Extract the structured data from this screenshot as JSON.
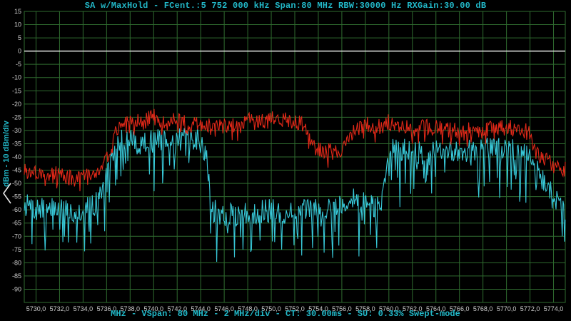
{
  "title": "SA w/MaxHold - FCent.:5 752 000 kHz Span:80 MHz RBW:30000 Hz RXGain:30.00 dB",
  "footer": "MHz - VSpan: 80 MHz - 2 MHz/div - CT: 30.00ms - SU: 0.33% Swept-mode",
  "y_axis_label": "dBm - 10 dBm/div",
  "colors": {
    "background": "#000000",
    "grid": "#2f6b2f",
    "text": "#22b8c8",
    "maxhold_trace": "#e02818",
    "live_trace": "#38c8d8",
    "reference_line": "#e6e6e6"
  },
  "icons": {
    "left_arrow": "chevron-left-icon"
  },
  "chart_data": {
    "type": "line",
    "title": "SA w/MaxHold - FCent.:5 752 000 kHz Span:80 MHz RBW:30000 Hz RXGain:30.00 dB",
    "xlabel": "MHz",
    "ylabel": "dBm - 10 dBm/div",
    "xlim": [
      5729.0,
      5775.0
    ],
    "ylim": [
      -95,
      15
    ],
    "grid": true,
    "x_ticks": [
      "5730,0",
      "5732,0",
      "5734,0",
      "5736,0",
      "5738,0",
      "5740,0",
      "5742,0",
      "5744,0",
      "5746,0",
      "5748,0",
      "5750,0",
      "5752,0",
      "5754,0",
      "5756,0",
      "5758,0",
      "5760,0",
      "5762,0",
      "5764,0",
      "5766,0",
      "5768,0",
      "5770,0",
      "5772,0",
      "5774,0"
    ],
    "y_ticks": [
      "15",
      "10",
      "5",
      "0",
      "-5",
      "-10",
      "-15",
      "-20",
      "-25",
      "-30",
      "-35",
      "-40",
      "-45",
      "-50",
      "-55",
      "-60",
      "-65",
      "-70",
      "-75",
      "-80",
      "-85",
      "-90"
    ],
    "reference_line_y": 0,
    "series": [
      {
        "role": "max hold",
        "color": "#e02818",
        "x": [
          5729.0,
          5730.0,
          5731.0,
          5732.0,
          5733.0,
          5734.0,
          5735.0,
          5735.5,
          5736.0,
          5736.5,
          5737.0,
          5737.5,
          5738.0,
          5739.0,
          5740.0,
          5741.0,
          5742.0,
          5743.0,
          5744.0,
          5745.0,
          5746.0,
          5747.0,
          5748.0,
          5749.0,
          5750.0,
          5751.0,
          5752.0,
          5752.8,
          5753.2,
          5754.0,
          5755.0,
          5756.0,
          5756.5,
          5757.0,
          5758.0,
          5759.0,
          5760.0,
          5761.0,
          5762.0,
          5763.0,
          5764.0,
          5765.0,
          5766.0,
          5767.0,
          5768.0,
          5769.0,
          5770.0,
          5771.0,
          5772.0,
          5772.5,
          5773.0,
          5774.0,
          5775.0
        ],
        "y": [
          -45,
          -46,
          -46,
          -47,
          -48,
          -48,
          -47,
          -45,
          -40,
          -35,
          -28,
          -27,
          -26,
          -26,
          -25,
          -27,
          -26,
          -28,
          -28,
          -28,
          -28,
          -27,
          -26,
          -27,
          -25,
          -26,
          -27,
          -28,
          -34,
          -37,
          -38,
          -39,
          -32,
          -30,
          -28,
          -28,
          -27,
          -29,
          -29,
          -29,
          -29,
          -30,
          -30,
          -30,
          -30,
          -29,
          -29,
          -29,
          -31,
          -38,
          -40,
          -43,
          -45
        ]
      },
      {
        "role": "live",
        "color": "#38c8d8",
        "x": [
          5729.0,
          5730.0,
          5731.0,
          5732.0,
          5733.0,
          5734.0,
          5735.0,
          5735.5,
          5736.0,
          5736.5,
          5737.0,
          5737.5,
          5738.0,
          5739.0,
          5740.0,
          5741.0,
          5742.0,
          5743.0,
          5744.0,
          5744.5,
          5745.0,
          5746.0,
          5747.0,
          5748.0,
          5749.0,
          5750.0,
          5751.0,
          5752.0,
          5753.0,
          5754.0,
          5755.0,
          5756.0,
          5757.0,
          5758.0,
          5759.0,
          5759.5,
          5760.0,
          5761.0,
          5762.0,
          5763.0,
          5764.0,
          5765.0,
          5766.0,
          5767.0,
          5768.0,
          5769.0,
          5770.0,
          5771.0,
          5772.0,
          5773.0,
          5774.0,
          5775.0
        ],
        "y": [
          -58,
          -60,
          -60,
          -59,
          -61,
          -60,
          -58,
          -54,
          -47,
          -40,
          -34,
          -34,
          -33,
          -35,
          -34,
          -34,
          -33,
          -34,
          -33,
          -40,
          -60,
          -62,
          -62,
          -61,
          -61,
          -60,
          -61,
          -61,
          -60,
          -60,
          -59,
          -58,
          -56,
          -58,
          -59,
          -55,
          -38,
          -37,
          -38,
          -39,
          -38,
          -39,
          -37,
          -38,
          -36,
          -37,
          -37,
          -38,
          -39,
          -48,
          -55,
          -60
        ]
      }
    ]
  }
}
